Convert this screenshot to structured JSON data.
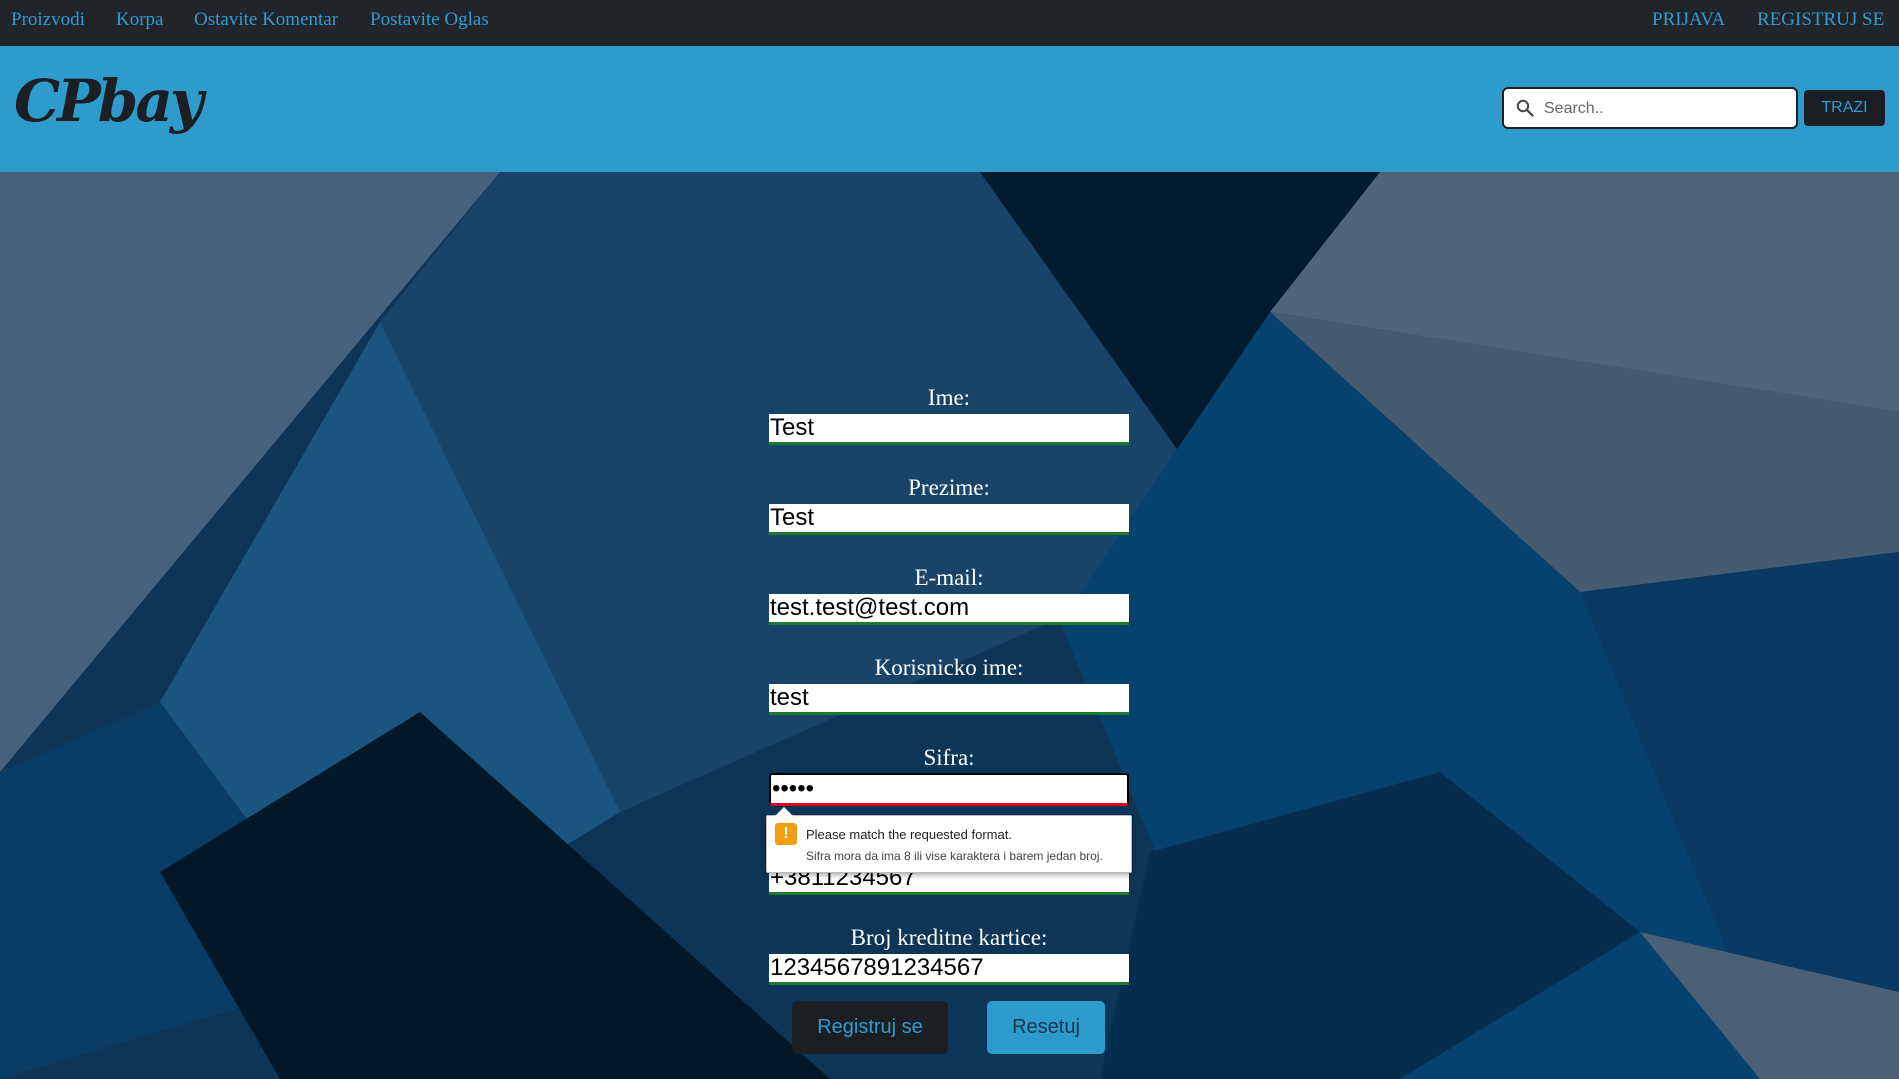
{
  "topnav": {
    "left_links": [
      "Proizvodi",
      "Korpa",
      "Ostavite Komentar",
      "Postavite Oglas"
    ],
    "right_links": [
      "PRIJAVA",
      "REGISTRUJ SE"
    ]
  },
  "header": {
    "logo": "CPbay",
    "search_placeholder": "Search..",
    "search_button": "TRAZI"
  },
  "form": {
    "fields": [
      {
        "label": "Ime:",
        "value": "Test"
      },
      {
        "label": "Prezime:",
        "value": "Test"
      },
      {
        "label": "E-mail:",
        "value": "test.test@test.com"
      },
      {
        "label": "Korisnicko ime:",
        "value": "test"
      },
      {
        "label": "Sifra:",
        "value": "•••••"
      },
      {
        "label": "",
        "value": "+3811234567"
      },
      {
        "label": "Broj kreditne kartice:",
        "value": "1234567891234567"
      }
    ],
    "validation": {
      "title": "Please match the requested format.",
      "detail": "Sifra mora da ima 8 ili vise karaktera i barem jedan broj."
    },
    "register_button": "Registruj se",
    "reset_button": "Resetuj"
  },
  "colors": {
    "topnav_bg": "#212529",
    "header_bg": "#2d9ccd",
    "link": "#2f9bd1",
    "input_valid_border": "#1d7a2d",
    "input_invalid_border": "#e0001b",
    "warning": "#f29e0e"
  },
  "icons": [
    "search-icon",
    "warning-icon"
  ]
}
